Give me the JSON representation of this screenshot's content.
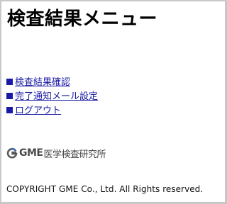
{
  "page": {
    "title": "検査結果メニュー"
  },
  "menu": {
    "items": [
      {
        "label": "検査結果確認",
        "icon": "square-bullet-icon"
      },
      {
        "label": "完了通知メール設定",
        "icon": "square-bullet-icon"
      },
      {
        "label": "ログアウト",
        "icon": "square-bullet-icon"
      }
    ],
    "link_color": "#1a1aa6"
  },
  "logo": {
    "mark_icon": "gme-g-logo-icon",
    "brand": "GME",
    "name": "医学検査研究所"
  },
  "footer": {
    "copyright": "COPYRIGHT GME Co., Ltd. All Rights reserved."
  }
}
